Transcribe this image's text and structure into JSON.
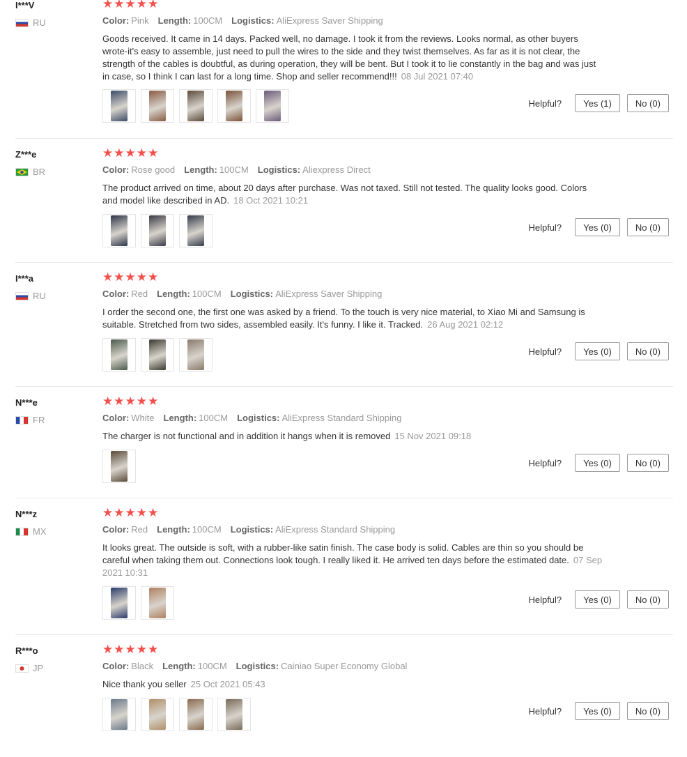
{
  "labels": {
    "color": "Color:",
    "length": "Length:",
    "logistics": "Logistics:",
    "helpful": "Helpful?"
  },
  "star_color": "#f2504b",
  "reviews": [
    {
      "user": "I***V",
      "country": "RU",
      "flag": "russia-flag-icon",
      "rating": 5,
      "color": "Pink",
      "length": "100CM",
      "logistics": "AliExpress Saver Shipping",
      "text": "Goods received. It came in 14 days. Packed well, no damage. I took it from the reviews. Looks normal, as other buyers wrote-it's easy to assemble, just need to pull the wires to the side and they twist themselves. As far as it is not clear, the strength of the cables is doubtful, as during operation, they will be bent. But I took it to lie constantly in the bag and was just in case, so I think I can last for a long time. Shop and seller recommend!!!",
      "date": "08 Jul 2021 07:40",
      "yes": "Yes (1)",
      "no": "No (0)",
      "photos": [
        "#3a4a66",
        "#8a5a44",
        "#5c4a3a",
        "#7a5238",
        "#6a5a7a"
      ]
    },
    {
      "user": "Z***e",
      "country": "BR",
      "flag": "brazil-flag-icon",
      "rating": 5,
      "color": "Rose good",
      "length": "100CM",
      "logistics": "Aliexpress Direct",
      "text": "The product arrived on time, about 20 days after purchase. Was not taxed. Still not tested. The quality looks good. Colors and model like described in AD.",
      "date": "18 Oct 2021 10:21",
      "yes": "Yes (0)",
      "no": "No (0)",
      "photos": [
        "#2c3448",
        "#3a3a44",
        "#343c4a"
      ]
    },
    {
      "user": "I***a",
      "country": "RU",
      "flag": "russia-flag-icon",
      "rating": 5,
      "color": "Red",
      "length": "100CM",
      "logistics": "AliExpress Saver Shipping",
      "text": "I order the second one, the first one was asked by a friend. To the touch is very nice material, to Xiao Mi and Samsung is suitable. Stretched from two sides, assembled easily. It's funny. I like it. Tracked.",
      "date": "26 Aug 2021 02:12",
      "yes": "Yes (0)",
      "no": "No (0)",
      "photos": [
        "#4a5a4a",
        "#3a3a30",
        "#8a7a6a"
      ]
    },
    {
      "user": "N***e",
      "country": "FR",
      "flag": "france-flag-icon",
      "rating": 5,
      "color": "White",
      "length": "100CM",
      "logistics": "AliExpress Standard Shipping",
      "text": "The charger is not functional and in addition it hangs when it is removed",
      "date": "15 Nov 2021 09:18",
      "yes": "Yes (0)",
      "no": "No (0)",
      "photos": [
        "#5a4a3a"
      ]
    },
    {
      "user": "N***z",
      "country": "MX",
      "flag": "mexico-flag-icon",
      "rating": 5,
      "color": "Red",
      "length": "100CM",
      "logistics": "AliExpress Standard Shipping",
      "text": "It looks great. The outside is soft, with a rubber-like satin finish. The case body is solid. Cables are thin so you should be careful when taking them out. Connections look tough. I really liked it. He arrived ten days before the estimated date.",
      "date": "07 Sep 2021 10:31",
      "yes": "Yes (0)",
      "no": "No (0)",
      "photos": [
        "#2a3a6a",
        "#b08060"
      ]
    },
    {
      "user": "R***o",
      "country": "JP",
      "flag": "japan-flag-icon",
      "rating": 5,
      "color": "Black",
      "length": "100CM",
      "logistics": "Cainiao Super Economy Global",
      "text": "Nice thank you seller",
      "date": "25 Oct 2021 05:43",
      "yes": "Yes (0)",
      "no": "No (0)",
      "photos": [
        "#6a7a8a",
        "#b0906a",
        "#8a6a50",
        "#7a6a5a"
      ]
    }
  ]
}
